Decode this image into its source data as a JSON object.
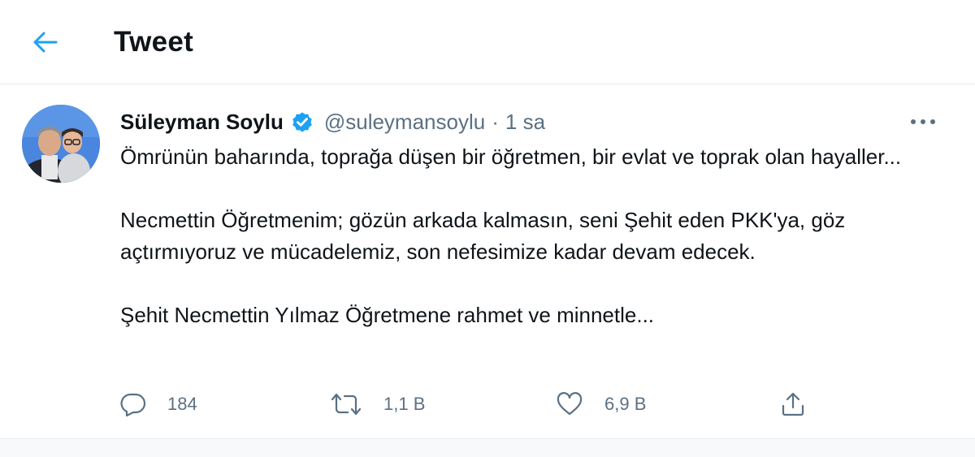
{
  "header": {
    "title": "Tweet",
    "back_icon": "arrow-left-icon"
  },
  "tweet": {
    "author": {
      "display_name": "Süleyman Soylu",
      "verified": true,
      "handle": "@suleymansoylu",
      "separator": "·",
      "time": "1 sa"
    },
    "text": {
      "paragraph_1": "Ömrünün baharında, toprağa düşen bir öğretmen, bir evlat ve toprak olan hayaller...",
      "paragraph_2": "Necmettin Öğretmenim; gözün arkada kalmasın, seni Şehit eden PKK'ya, göz açtırmıyoruz ve mücadelemiz, son nefesimize kadar devam edecek.",
      "paragraph_3": "Şehit Necmettin Yılmaz Öğretmene rahmet ve minnetle..."
    },
    "actions": {
      "reply_count": "184",
      "retweet_count": "1,1 B",
      "like_count": "6,9 B"
    }
  },
  "colors": {
    "accent": "#1da1f2",
    "muted": "#5b7083",
    "border": "#e6ecf0",
    "text": "#0f1419"
  }
}
